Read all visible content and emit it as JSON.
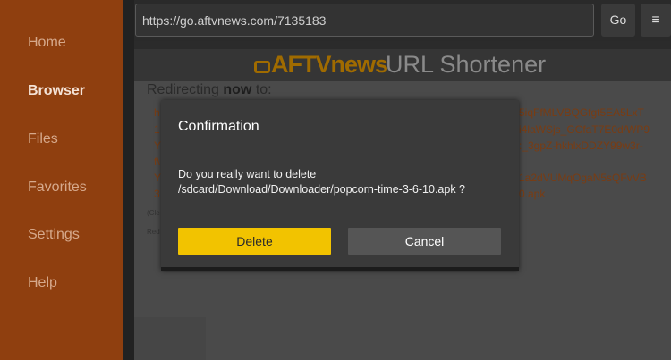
{
  "sidebar": {
    "items": [
      {
        "label": "Home"
      },
      {
        "label": "Browser",
        "active": true
      },
      {
        "label": "Files"
      },
      {
        "label": "Favorites"
      },
      {
        "label": "Settings"
      },
      {
        "label": "Help"
      }
    ]
  },
  "topbar": {
    "url": "https://go.aftvnews.com/7135183",
    "go_label": "Go",
    "menu_icon": "≡"
  },
  "page": {
    "banner_logo": "AFTVnews",
    "banner_title": "URL Shortener",
    "redirect_prefix": "Redirecting ",
    "redirect_bold": "now",
    "redirect_suffix": " to:",
    "link_fragments": [
      "h",
      "1",
      "Y",
      "f\\",
      "Y",
      "3",
      "5iqFfMLVBQGfgt5EA5LxT",
      "i4laWSjs_GCfaT7E0d/WP9",
      ":_3gpZ-hkhlxDDZY99w3r-",
      "1a2dVUMqOgaN5sQFvVB",
      "0.apk"
    ],
    "small_texts": [
      "(Cle",
      "Red"
    ]
  },
  "dialog": {
    "title": "Confirmation",
    "message": "Do you really want to delete /sdcard/Download/Downloader/popcorn-time-3-6-10.apk ?",
    "delete_label": "Delete",
    "cancel_label": "Cancel"
  },
  "colors": {
    "sidebar_bg": "#8f3f0f",
    "accent": "#f2c300",
    "dialog_bg": "#3a3a3a"
  }
}
